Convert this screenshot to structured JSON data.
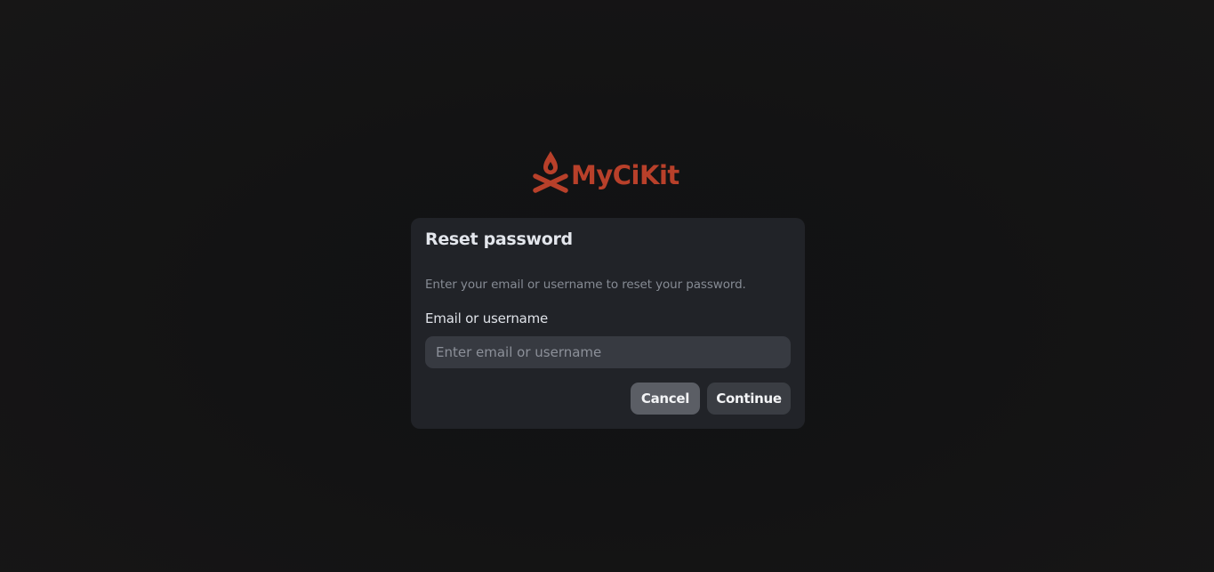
{
  "brand": {
    "name": "MyCiKit",
    "color": "#b8402a",
    "icon": "campfire-icon"
  },
  "dialog": {
    "title": "Reset password",
    "description": "Enter your email or username to reset your password.",
    "field_label": "Email or username",
    "field_value": "",
    "field_placeholder": "Enter email or username",
    "cancel_label": "Cancel",
    "continue_label": "Continue"
  }
}
